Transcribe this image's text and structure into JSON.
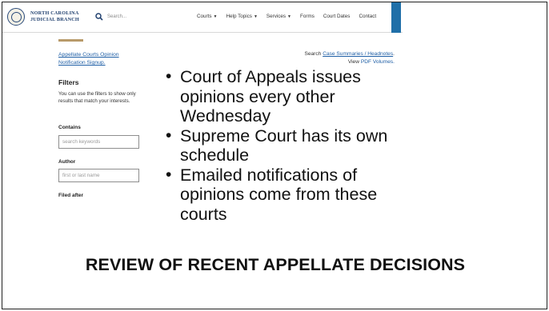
{
  "header": {
    "brand_line1": "NORTH CAROLINA",
    "brand_line2": "JUDICIAL BRANCH",
    "search_placeholder": "Search...",
    "nav": [
      {
        "label": "Courts",
        "dropdown": true
      },
      {
        "label": "Help Topics",
        "dropdown": true
      },
      {
        "label": "Services",
        "dropdown": true
      },
      {
        "label": "Forms",
        "dropdown": false
      },
      {
        "label": "Court Dates",
        "dropdown": false
      },
      {
        "label": "Contact",
        "dropdown": false
      }
    ]
  },
  "sidebar": {
    "signup_link_line1": "Appellate Courts Opinion",
    "signup_link_line2": "Notification Signup.",
    "filters_heading": "Filters",
    "filters_description": "You can use the filters to show only results that match your interests.",
    "contains_label": "Contains",
    "contains_placeholder": "search keywords",
    "author_label": "Author",
    "author_placeholder": "first or last name",
    "filed_after_label": "Filed after"
  },
  "links": {
    "search_prefix": "Search",
    "case_summaries": "Case Summaries / Headnotes",
    "period": ".",
    "view_prefix": "View",
    "pdf_volumes": "PDF Volumes."
  },
  "slide": {
    "bullets": [
      "Court of Appeals issues opinions every other Wednesday",
      "Supreme Court has its own schedule",
      "Emailed notifications of opinions come from these courts"
    ],
    "title": "REVIEW OF RECENT APPELLATE DECISIONS"
  },
  "colors": {
    "link": "#1f5fa6",
    "brand": "#1f3f6e",
    "accent_tab": "#1f6fa8",
    "gold_rule": "#b89a6a"
  }
}
